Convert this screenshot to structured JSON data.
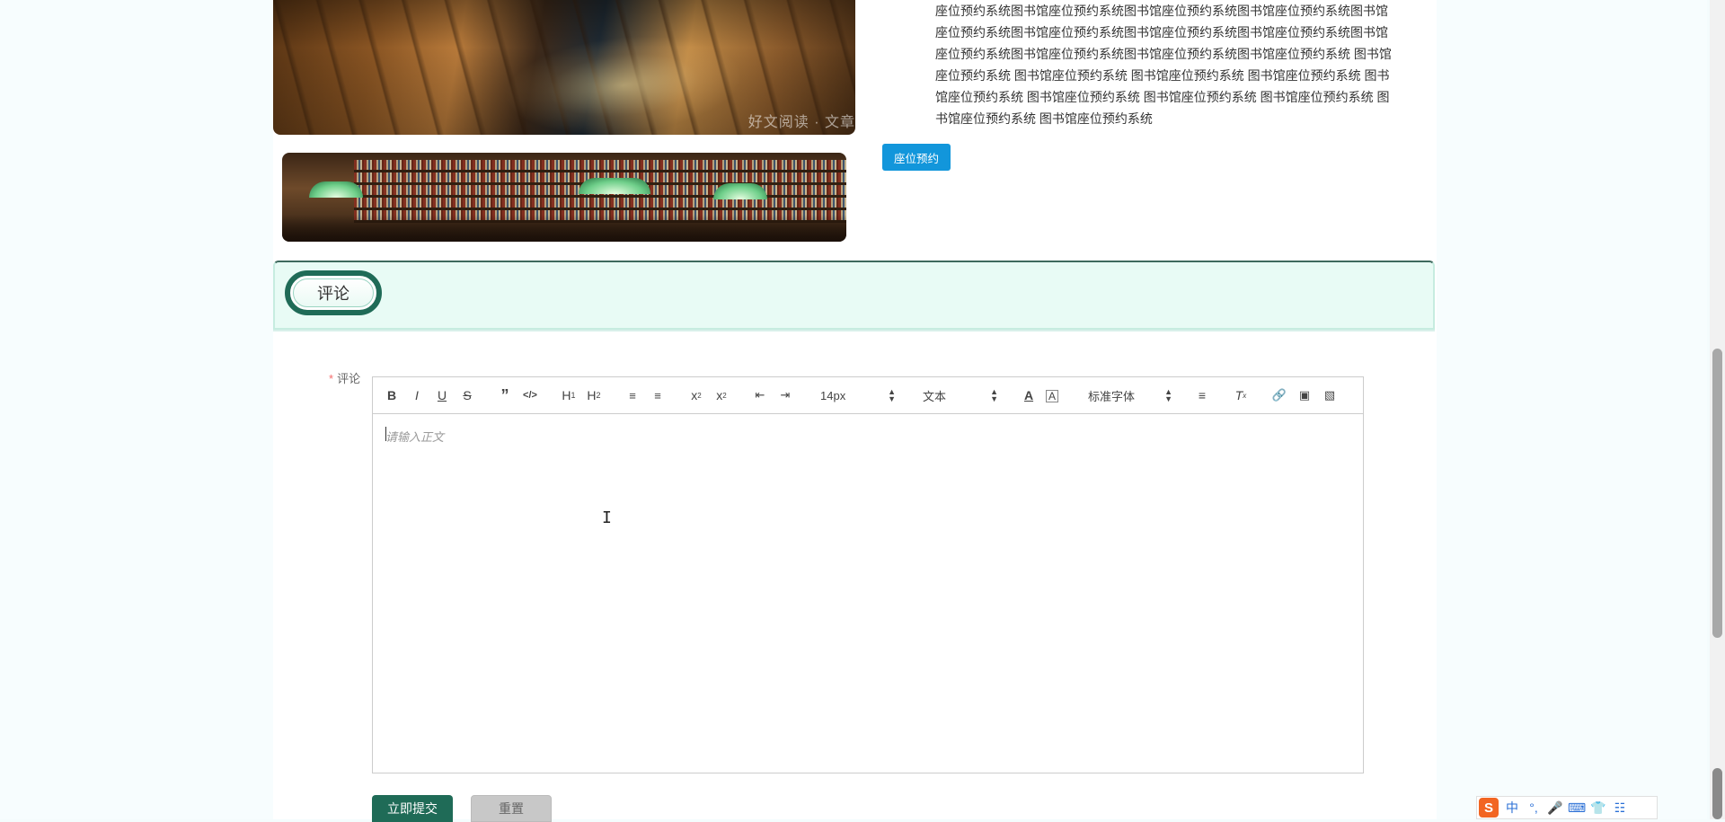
{
  "images": {
    "reading_room_watermark": "好文阅读 · 文章"
  },
  "description": "座位预约系统图书馆座位预约系统图书馆座位预约系统图书馆座位预约系统图书馆座位预约系统图书馆座位预约系统图书馆座位预约系统图书馆座位预约系统图书馆座位预约系统图书馆座位预约系统图书馆座位预约系统图书馆座位预约系统 图书馆座位预约系统 图书馆座位预约系统 图书馆座位预约系统 图书馆座位预约系统 图书馆座位预约系统 图书馆座位预约系统 图书馆座位预约系统 图书馆座位预约系统 图书馆座位预约系统 图书馆座位预约系统",
  "reserve_button": "座位预约",
  "comments": {
    "section_title": "评论",
    "field_label": "评论",
    "required_mark": "*",
    "editor": {
      "placeholder": "请输入正文",
      "font_size": "14px",
      "block_type": "文本",
      "font_family": "标准字体",
      "toolbar_icons": [
        "bold-icon",
        "italic-icon",
        "underline-icon",
        "strikethrough-icon",
        "blockquote-icon",
        "code-icon",
        "heading1-icon",
        "heading2-icon",
        "ordered-list-icon",
        "bullet-list-icon",
        "subscript-icon",
        "superscript-icon",
        "outdent-icon",
        "indent-icon",
        "font-color-icon",
        "background-color-icon",
        "align-icon",
        "clear-format-icon",
        "link-icon",
        "image-icon",
        "video-icon"
      ]
    },
    "submit_label": "立即提交",
    "reset_label": "重置"
  },
  "ime": {
    "mode": "中",
    "punct": "°,"
  },
  "colors": {
    "primary": "#1f6b57",
    "reserve_button": "#1296db",
    "header_bg": "#e8fbf5",
    "required": "#f56c6c"
  }
}
